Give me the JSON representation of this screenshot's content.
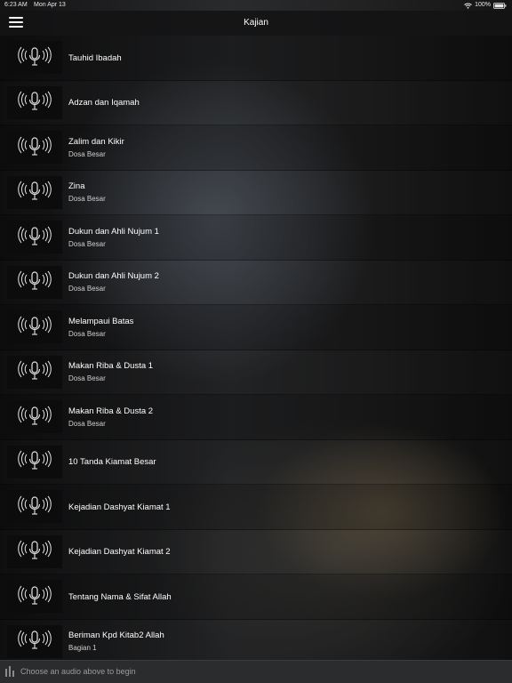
{
  "status_bar": {
    "time": "6:23 AM",
    "date": "Mon Apr 13",
    "battery": "100%"
  },
  "nav": {
    "title": "Kajian",
    "menu_icon": "hamburger-menu-icon"
  },
  "items": [
    {
      "title": "Tauhid Ibadah",
      "subtitle": ""
    },
    {
      "title": "Adzan dan Iqamah",
      "subtitle": ""
    },
    {
      "title": "Zalim dan Kikir",
      "subtitle": "Dosa Besar"
    },
    {
      "title": "Zina",
      "subtitle": "Dosa Besar"
    },
    {
      "title": "Dukun dan Ahli Nujum 1",
      "subtitle": "Dosa Besar"
    },
    {
      "title": "Dukun dan Ahli Nujum 2",
      "subtitle": "Dosa Besar"
    },
    {
      "title": "Melampaui Batas",
      "subtitle": "Dosa Besar"
    },
    {
      "title": "Makan Riba & Dusta 1",
      "subtitle": "Dosa Besar"
    },
    {
      "title": "Makan Riba & Dusta 2",
      "subtitle": "Dosa Besar"
    },
    {
      "title": "10 Tanda Kiamat Besar",
      "subtitle": ""
    },
    {
      "title": "Kejadian Dashyat Kiamat 1",
      "subtitle": ""
    },
    {
      "title": "Kejadian Dashyat Kiamat 2",
      "subtitle": ""
    },
    {
      "title": "Tentang Nama & Sifat Allah",
      "subtitle": ""
    },
    {
      "title": "Beriman Kpd Kitab2 Allah",
      "subtitle": "Bagian 1"
    }
  ],
  "item_icon": "broadcast-microphone-icon",
  "player": {
    "placeholder": "Choose an audio above to begin",
    "icon": "audio-bars-icon"
  }
}
